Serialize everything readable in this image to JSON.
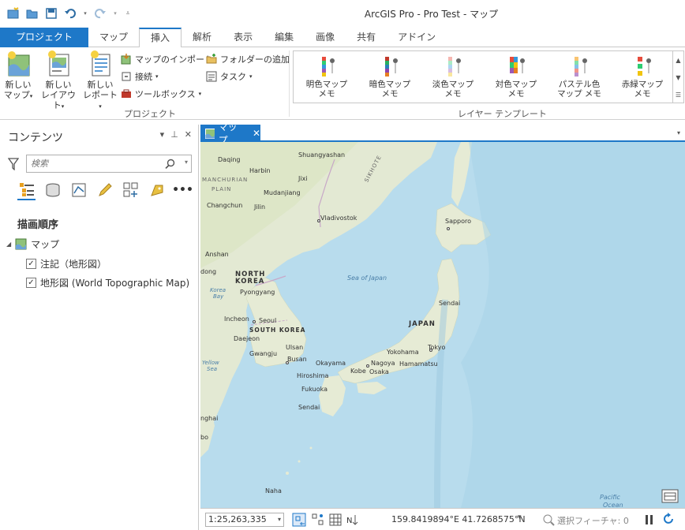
{
  "window": {
    "title": "ArcGIS Pro - Pro Test - マップ"
  },
  "ribbon_tabs": [
    {
      "label": "プロジェクト"
    },
    {
      "label": "マップ"
    },
    {
      "label": "挿入"
    },
    {
      "label": "解析"
    },
    {
      "label": "表示"
    },
    {
      "label": "編集"
    },
    {
      "label": "画像"
    },
    {
      "label": "共有"
    },
    {
      "label": "アドイン"
    }
  ],
  "project_group": {
    "label": "プロジェクト",
    "new_map": {
      "line1": "新しい",
      "line2": "マップ"
    },
    "new_layout": {
      "line1": "新しい",
      "line2": "レイアウト"
    },
    "new_report": {
      "line1": "新しい",
      "line2": "レポート"
    },
    "import_map": "マップのインポート",
    "connect": "接続",
    "toolbox": "ツールボックス",
    "add_folder": "フォルダーの追加",
    "task": "タスク"
  },
  "layer_template_group": {
    "label": "レイヤー テンプレート",
    "items": [
      {
        "line1": "明色マップ",
        "line2": "メモ"
      },
      {
        "line1": "暗色マップ",
        "line2": "メモ"
      },
      {
        "line1": "淡色マップ",
        "line2": "メモ"
      },
      {
        "line1": "対色マップ",
        "line2": "メモ"
      },
      {
        "line1": "パステル色",
        "line2": "マップ メモ"
      },
      {
        "line1": "赤緑マップ",
        "line2": "メモ"
      }
    ]
  },
  "contents_pane": {
    "title": "コンテンツ",
    "search_placeholder": "検索",
    "drawing_order": "描画順序",
    "map_name": "マップ",
    "layers": [
      {
        "label": "注記（地形図）",
        "checked": true
      },
      {
        "label": "地形図 (World Topographic Map)",
        "checked": true
      }
    ]
  },
  "map_view": {
    "tab_label": "マップ",
    "labels": {
      "daqing": "Daqing",
      "shuangyashan": "Shuangyashan",
      "harbin": "Harbin",
      "jixi": "Jixi",
      "manchurian": "MANCHURIAN",
      "plain": "PLAIN",
      "mudanjiang": "Mudanjiang",
      "changchun": "Changchun",
      "jilin": "Jilin",
      "vladivostok": "Vladivostok",
      "sikhote": "SIKHOTE",
      "sapporo": "Sapporo",
      "anshan": "Anshan",
      "dong": "dong",
      "north": "NORTH",
      "korea1": "KOREA",
      "sea_of_japan": "Sea of Japan",
      "korea_bay1": "Korea",
      "korea_bay2": "Bay",
      "pyongyang": "Pyongyang",
      "sendai": "Sendai",
      "incheon": "Incheon",
      "seoul": "Seoul",
      "japan": "JAPAN",
      "south_korea": "SOUTH KOREA",
      "daejeon": "Daejeon",
      "ulsan": "Ulsan",
      "tokyo": "Tokyo",
      "gwangju": "Gwangju",
      "busan": "Busan",
      "yokohama": "Yokohama",
      "yellow": "Yellow",
      "sea": "Sea",
      "okayama": "Okayama",
      "nagoya": "Nagoya",
      "hamamatsu": "Hamamatsu",
      "kobe": "Kobe",
      "osaka": "Osaka",
      "hiroshima": "Hiroshima",
      "fukuoka": "Fukuoka",
      "sendai_kyushu": "Sendai",
      "nghai": "nghai",
      "bo": "bo",
      "naha": "Naha",
      "pacific": "Pacific",
      "ocean": "Ocean"
    }
  },
  "status_bar": {
    "scale": "1:25,263,335",
    "coordinates": "159.8419894°E 41.7268575°N",
    "selected_features": "選択フィーチャ: 0"
  }
}
